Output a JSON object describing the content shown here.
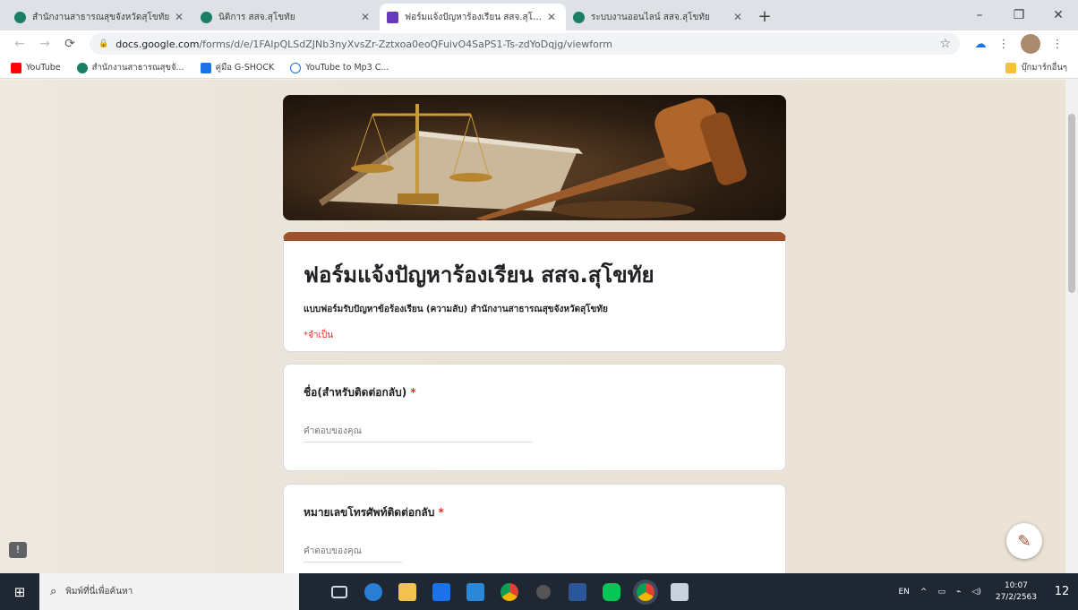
{
  "browser": {
    "tabs": [
      {
        "label": "สำนักงานสาธารณสุขจังหวัดสุโขทัย",
        "active": false
      },
      {
        "label": "นิติการ สสจ.สุโขทัย",
        "active": false
      },
      {
        "label": "ฟอร์มแจ้งปัญหาร้องเรียน สสจ.สุโขทัย",
        "active": true
      },
      {
        "label": "ระบบงานออนไลน์ สสจ.สุโขทัย",
        "active": false
      }
    ],
    "url_domain": "docs.google.com",
    "url_path": "/forms/d/e/1FAIpQLSdZJNb3nyXvsZr-Zztxoa0eoQFuivO4SaPS1-Ts-zdYoDqjg/viewform",
    "bookmarks": [
      {
        "label": "YouTube",
        "icon": "youtube-icon"
      },
      {
        "label": "สำนักงานสาธารณสุขจั...",
        "icon": "site-icon"
      },
      {
        "label": "คู่มือ G-SHOCK",
        "icon": "bookmark-icon"
      },
      {
        "label": "YouTube to Mp3 C...",
        "icon": "cloud-icon"
      }
    ],
    "other_bookmarks": "บุ๊กมาร์กอื่นๆ"
  },
  "form": {
    "title": "ฟอร์มแจ้งปัญหาร้องเรียน สสจ.สุโขทัย",
    "description": "แบบฟอร์มรับปัญหาข้อร้องเรียน (ความลับ) สำนักงานสาธารณสุขจังหวัดสุโขทัย",
    "required_note": "*จำเป็น",
    "questions": [
      {
        "label": "ชื่อ(สำหรับติดต่อกลับ)",
        "required_mark": "*",
        "placeholder": "คำตอบของคุณ"
      },
      {
        "label": "หมายเลขโทรศัพท์ติดต่อกลับ",
        "required_mark": "*",
        "placeholder": "คำตอบของคุณ"
      }
    ]
  },
  "taskbar": {
    "search_placeholder": "พิมพ์ที่นี่เพื่อค้นหา",
    "language": "EN",
    "time": "10:07",
    "date": "27/2/2563",
    "notification_count": "12"
  },
  "colors": {
    "theme_accent": "#a0522d",
    "required_red": "#d93025",
    "taskbar_bg": "#1f2733"
  }
}
